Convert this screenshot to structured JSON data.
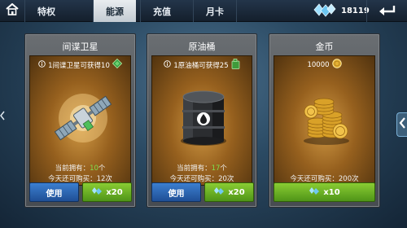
{
  "topbar": {
    "tabs": [
      {
        "label": "特权",
        "active": false
      },
      {
        "label": "能源",
        "active": true
      },
      {
        "label": "充值",
        "active": false
      },
      {
        "label": "月卡",
        "active": false
      }
    ],
    "crystal_count": "18119",
    "icons": {
      "home": "home-icon",
      "crystal": "crystal-icon",
      "back": "back-arrow-icon"
    }
  },
  "cards": [
    {
      "title": "间谍卫星",
      "info_text": "1间谍卫星可获得10",
      "info_icon": "green-gem-icon",
      "owned_label": "当前拥有：",
      "owned_value": "10",
      "owned_unit": "个",
      "purchasable_text": "今天还可购买：12次",
      "use_label": "使用",
      "price": "x20",
      "art": "satellite-icon"
    },
    {
      "title": "原油桶",
      "info_text": "1原油桶可获得25",
      "info_icon": "fuel-can-icon",
      "owned_label": "当前拥有：",
      "owned_value": "17",
      "owned_unit": "个",
      "purchasable_text": "今天还可购买：20次",
      "use_label": "使用",
      "price": "x20",
      "art": "oil-barrel-icon"
    },
    {
      "title": "金币",
      "info_text": "10000",
      "info_icon": "gold-coin-icon",
      "purchasable_text": "今天还可购买：200次",
      "price": "x10",
      "art": "gold-coin-pile-icon"
    }
  ],
  "colors": {
    "tab_active_bg": "#dfe4e8",
    "highlight_green": "#7fe04f",
    "button_blue": "#2e6bbd",
    "button_green": "#6db326"
  }
}
